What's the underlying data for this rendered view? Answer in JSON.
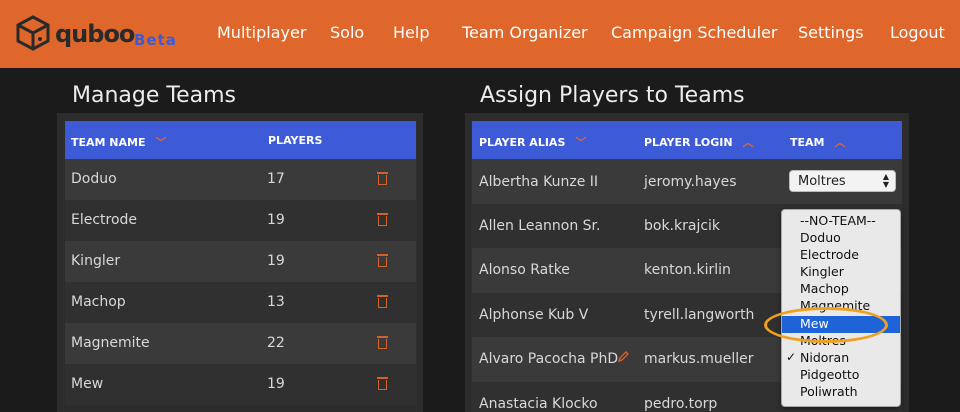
{
  "brand": {
    "name": "quboo",
    "badge": "Beta",
    "logo_icon": "cube-logo-icon"
  },
  "nav": [
    "Multiplayer",
    "Solo",
    "Help",
    "Team Organizer",
    "Campaign Scheduler",
    "Settings",
    "Logout"
  ],
  "manage": {
    "title": "Manage Teams",
    "headers": [
      "TEAM NAME",
      "PLAYERS"
    ],
    "rows": [
      {
        "team": "Doduo",
        "players": "17"
      },
      {
        "team": "Electrode",
        "players": "19"
      },
      {
        "team": "Kingler",
        "players": "19"
      },
      {
        "team": "Machop",
        "players": "13"
      },
      {
        "team": "Magnemite",
        "players": "22"
      },
      {
        "team": "Mew",
        "players": "19"
      }
    ]
  },
  "assign": {
    "title": "Assign Players to Teams",
    "headers": [
      "PLAYER ALIAS",
      "PLAYER LOGIN",
      "TEAM"
    ],
    "rows": [
      {
        "alias": "Albertha Kunze II",
        "login": "jeromy.hayes"
      },
      {
        "alias": "Allen Leannon Sr.",
        "login": "bok.krajcik"
      },
      {
        "alias": "Alonso Ratke",
        "login": "kenton.kirlin"
      },
      {
        "alias": "Alphonse Kub V",
        "login": "tyrell.langworth"
      },
      {
        "alias": "Alvaro Pacocha PhD",
        "login": "markus.mueller"
      },
      {
        "alias": "Anastacia Klocko",
        "login": "pedro.torp"
      }
    ],
    "first_select_value": "Moltres"
  },
  "dropdown": {
    "options": [
      "--NO-TEAM--",
      "Doduo",
      "Electrode",
      "Kingler",
      "Machop",
      "Magnemite",
      "Mew",
      "Moltres",
      "Nidoran",
      "Pidgeotto",
      "Poliwrath"
    ],
    "highlighted": "Mew",
    "checked": "Nidoran"
  },
  "colors": {
    "accent": "#e0672b",
    "header_blue": "#3d5bd6",
    "highlight": "#1e63d8",
    "ring": "#f0a020"
  }
}
